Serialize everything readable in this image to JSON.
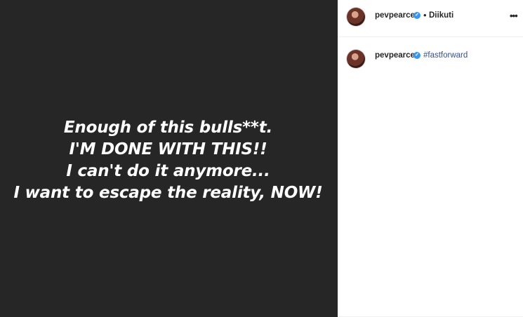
{
  "post": {
    "lines": [
      "Enough of this bulls**t.",
      "I'M DONE WITH THIS!!",
      "I can't do it anymore...",
      "I want to escape the reality, NOW!"
    ]
  },
  "header": {
    "username": "pevpearce",
    "separator": "•",
    "follow_label": "Diikuti",
    "more_label": "•••"
  },
  "caption": {
    "username": "pevpearce",
    "text": "#fastforward"
  },
  "colors": {
    "image_bg": "#262626",
    "verified_badge": "#3897f0",
    "hashtag": "#385185"
  },
  "icons": {
    "verified": "verified-badge-icon",
    "more": "more-options-icon"
  }
}
